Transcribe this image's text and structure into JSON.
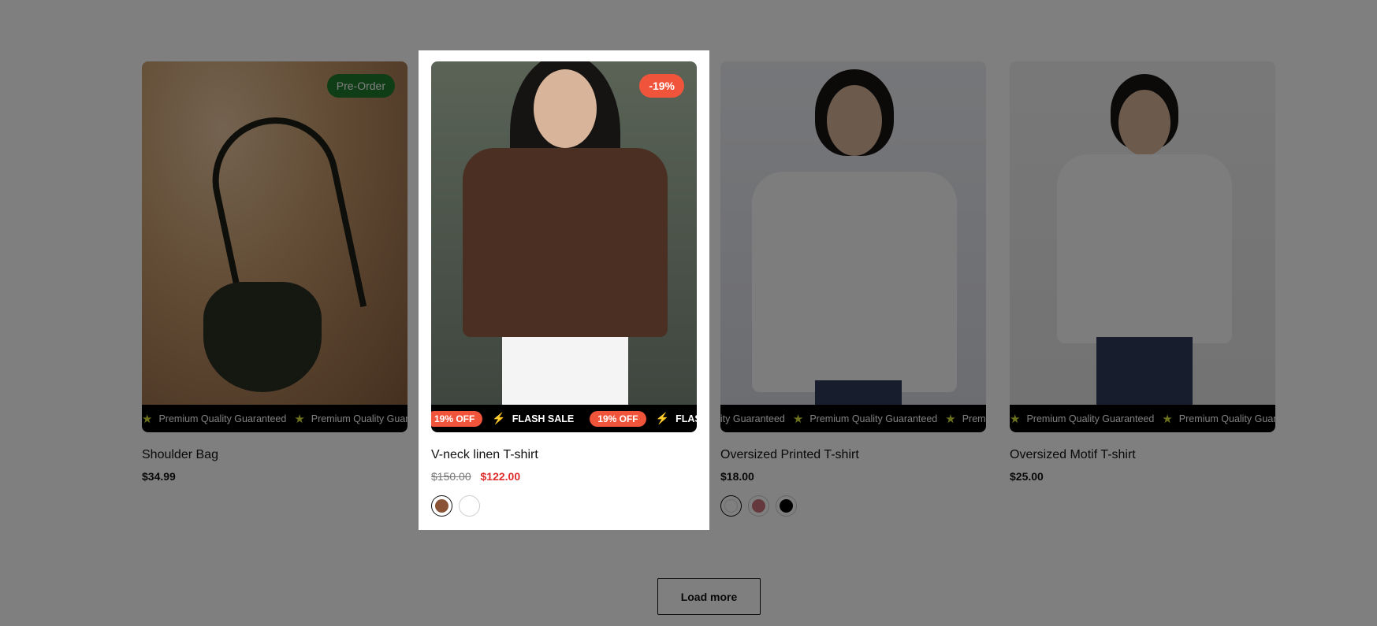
{
  "products": [
    {
      "title": "Shoulder Bag",
      "price": "$34.99",
      "badge": "Pre-Order",
      "marquee_text": "Premium Quality Guaranteed"
    },
    {
      "title": "V-neck linen T-shirt",
      "old_price": "$150.00",
      "sale_price": "$122.00",
      "badge": "-19%",
      "marquee_pill": "19% OFF",
      "marquee_flash": "FLASH SALE",
      "swatches": [
        "#8a5336",
        "#ffffff"
      ]
    },
    {
      "title": "Oversized Printed T-shirt",
      "price": "$18.00",
      "marquee_text": "Premium Quality Guaranteed",
      "swatches": [
        "#ffffff",
        "#c8707a",
        "#000000"
      ]
    },
    {
      "title": "Oversized Motif T-shirt",
      "price": "$25.00",
      "marquee_text": "Premium Quality Guaranteed"
    }
  ],
  "load_more_label": "Load more"
}
